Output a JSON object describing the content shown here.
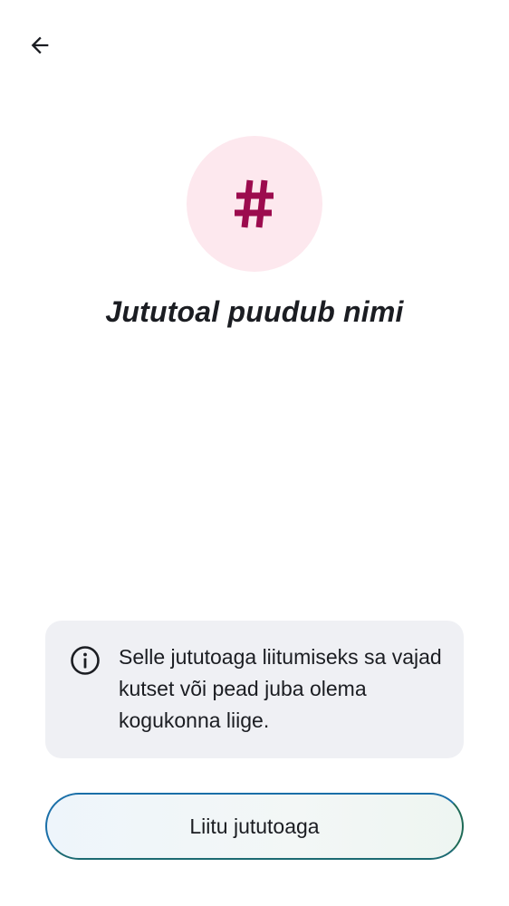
{
  "header": {
    "back_icon": "arrow-left-icon"
  },
  "room": {
    "avatar_icon": "hash-icon",
    "avatar_bg": "#fde8ee",
    "avatar_color": "#9c0b4e",
    "title": "Jututoal puudub nimi"
  },
  "info": {
    "icon": "info-icon",
    "text": "Selle jututoaga liitumiseks sa vajad kutset või pead juba olema kogukonna liige."
  },
  "actions": {
    "join_label": "Liitu jututoaga"
  }
}
